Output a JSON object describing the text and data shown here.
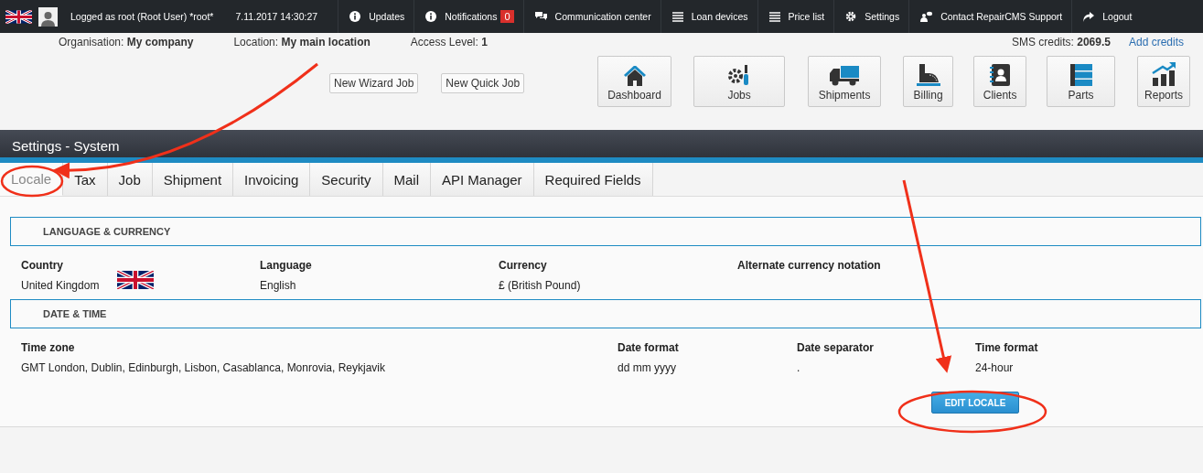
{
  "top_bar": {
    "user": "Logged as root (Root User) *root*",
    "datetime": "7.11.2017 14:30:27",
    "items": [
      {
        "kind": "info",
        "label": "Updates"
      },
      {
        "kind": "info",
        "label": "Notifications",
        "badge": "0"
      },
      {
        "kind": "chat",
        "label": "Communication center"
      },
      {
        "kind": "list",
        "label": "Loan devices"
      },
      {
        "kind": "list",
        "label": "Price list"
      },
      {
        "kind": "gear",
        "label": "Settings"
      },
      {
        "kind": "support",
        "label": "Contact RepairCMS Support"
      },
      {
        "kind": "logout",
        "label": "Logout"
      }
    ]
  },
  "info_bar": {
    "items": [
      {
        "label": "Organisation:",
        "value": "My company"
      },
      {
        "label": "Location:",
        "value": "My main location"
      },
      {
        "label": "Access Level:",
        "value": "1"
      }
    ],
    "sms_credits": {
      "label": "SMS credits:",
      "value": "2069.5"
    },
    "add_credits": "Add credits"
  },
  "quick_buttons": [
    "New Wizard Job",
    "New Quick Job"
  ],
  "nav_tiles": [
    {
      "kind": "home",
      "label": "Dashboard"
    },
    {
      "kind": "tools",
      "label": "Jobs"
    },
    {
      "kind": "truck",
      "label": "Shipments"
    },
    {
      "kind": "register",
      "label": "Billing"
    },
    {
      "kind": "contacts",
      "label": "Clients"
    },
    {
      "kind": "stack",
      "label": "Parts"
    },
    {
      "kind": "chart",
      "label": "Reports"
    }
  ],
  "page_title": "Settings - System",
  "tabs": [
    {
      "label": "Locale",
      "selected": true
    },
    {
      "label": "Tax",
      "selected": false
    },
    {
      "label": "Job",
      "selected": false
    },
    {
      "label": "Shipment",
      "selected": false
    },
    {
      "label": "Invoicing",
      "selected": false
    },
    {
      "label": "Security",
      "selected": false
    },
    {
      "label": "Mail",
      "selected": false
    },
    {
      "label": "API Manager",
      "selected": false
    },
    {
      "label": "Required Fields",
      "selected": false
    }
  ],
  "sections": [
    {
      "title": "LANGUAGE & CURRENCY",
      "fields": [
        {
          "label": "Country",
          "value": "United Kingdom",
          "kind": "flag"
        },
        {
          "label": "Language",
          "value": "English",
          "kind": "plain"
        },
        {
          "label": "Currency",
          "value": "£ (British Pound)",
          "kind": "plain"
        },
        {
          "label": "Alternate currency notation",
          "kind": "plain"
        }
      ]
    },
    {
      "title": "DATE & TIME",
      "fields": [
        {
          "label": "Time zone",
          "value": "GMT London, Dublin, Edinburgh, Lisbon, Casablanca, Monrovia, Reykjavik",
          "kind": "plain"
        },
        {
          "label": "Date format",
          "value": "dd mm yyyy",
          "kind": "plain"
        },
        {
          "label": "Date separator",
          "value": ".",
          "kind": "plain"
        },
        {
          "label": "Time format",
          "value": "24-hour",
          "kind": "plain"
        }
      ]
    }
  ],
  "edit_button": "EDIT LOCALE"
}
